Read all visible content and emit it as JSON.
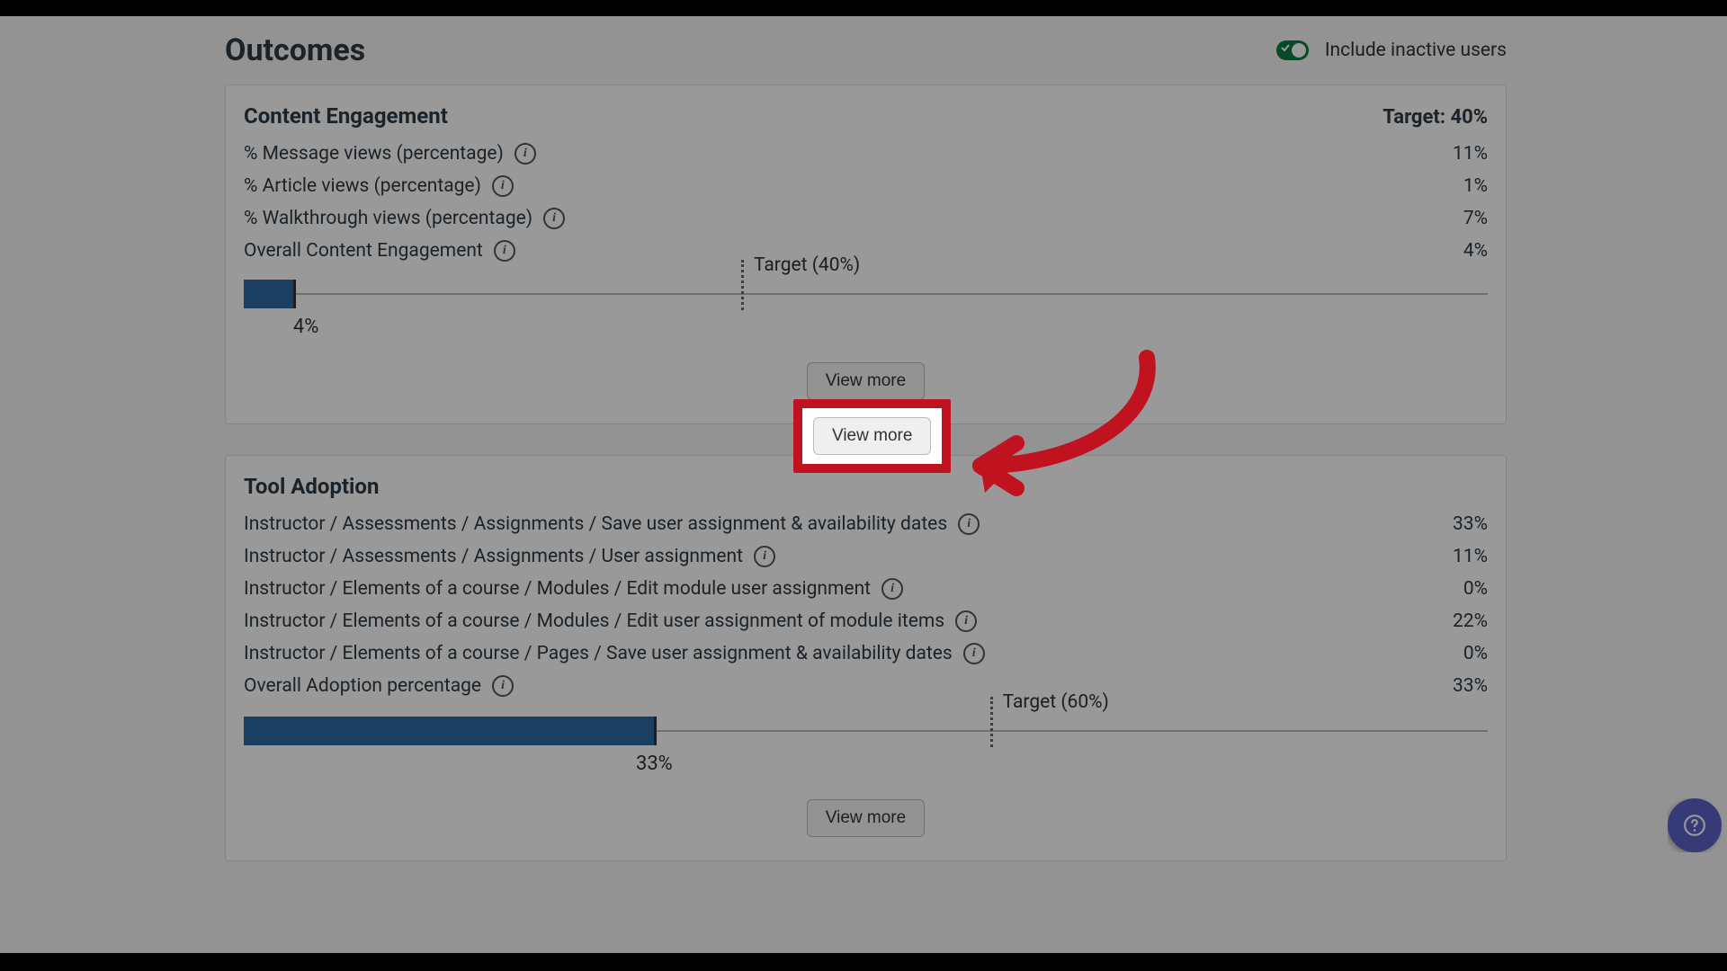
{
  "page_title": "Outcomes",
  "toggle_label": "Include inactive users",
  "cards": {
    "content_engagement": {
      "title": "Content Engagement",
      "target_label": "Target: 40%",
      "target_pct": 40,
      "target_marker_text": "Target (40%)",
      "rows": [
        {
          "label": "% Message views (percentage)",
          "value": "11%"
        },
        {
          "label": "% Article views (percentage)",
          "value": "1%"
        },
        {
          "label": "% Walkthrough views (percentage)",
          "value": "7%"
        },
        {
          "label": "Overall Content Engagement",
          "value": "4%"
        }
      ],
      "bar_value": 4,
      "bar_value_label": "4%",
      "view_more": "View more"
    },
    "tool_adoption": {
      "title": "Tool Adoption",
      "target_pct": 60,
      "target_marker_text": "Target (60%)",
      "rows": [
        {
          "label": "Instructor / Assessments / Assignments / Save user assignment & availability dates",
          "value": "33%"
        },
        {
          "label": "Instructor / Assessments / Assignments / User assignment",
          "value": "11%"
        },
        {
          "label": "Instructor / Elements of a course / Modules / Edit module user assignment",
          "value": "0%"
        },
        {
          "label": "Instructor / Elements of a course / Modules / Edit user assignment of module items",
          "value": "22%"
        },
        {
          "label": "Instructor / Elements of a course / Pages / Save user assignment & availability dates",
          "value": "0%"
        },
        {
          "label": "Overall Adoption percentage",
          "value": "33%"
        }
      ],
      "bar_value": 33,
      "bar_value_label": "33%",
      "view_more": "View more"
    }
  },
  "chart_data": [
    {
      "type": "bar",
      "title": "Overall Content Engagement",
      "categories": [
        "Overall Content Engagement"
      ],
      "values": [
        4
      ],
      "target": 40,
      "xlabel": "",
      "ylabel": "%",
      "ylim": [
        0,
        100
      ]
    },
    {
      "type": "bar",
      "title": "Overall Adoption percentage",
      "categories": [
        "Overall Adoption percentage"
      ],
      "values": [
        33
      ],
      "target": 60,
      "xlabel": "",
      "ylabel": "%",
      "ylim": [
        0,
        100
      ]
    }
  ]
}
